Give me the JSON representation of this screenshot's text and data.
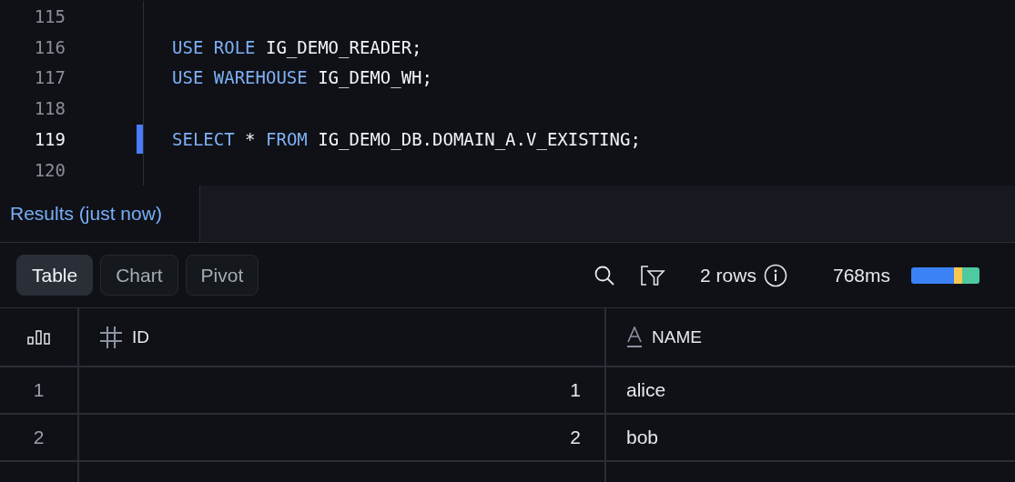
{
  "editor": {
    "lines": [
      {
        "number": "115",
        "current": false
      },
      {
        "number": "116",
        "current": false,
        "tokens": [
          {
            "kind": "keyword",
            "text": "USE ROLE"
          },
          {
            "kind": "ident",
            "text": "IG_DEMO_READER;"
          }
        ]
      },
      {
        "number": "117",
        "current": false,
        "tokens": [
          {
            "kind": "keyword",
            "text": "USE WAREHOUSE"
          },
          {
            "kind": "ident",
            "text": "IG_DEMO_WH;"
          }
        ]
      },
      {
        "number": "118",
        "current": false
      },
      {
        "number": "119",
        "current": true,
        "tokens": [
          {
            "kind": "keyword",
            "text": "SELECT"
          },
          {
            "kind": "ident",
            "text": "*"
          },
          {
            "kind": "keyword",
            "text": "FROM"
          },
          {
            "kind": "ident",
            "text": "IG_DEMO_DB.DOMAIN_A.V_EXISTING;"
          }
        ]
      },
      {
        "number": "120",
        "current": false
      }
    ]
  },
  "results": {
    "tab": {
      "label": "Results (just now)",
      "selected": true
    },
    "views": [
      {
        "label": "Table",
        "selected": true
      },
      {
        "label": "Chart",
        "selected": false
      },
      {
        "label": "Pivot",
        "selected": false
      }
    ],
    "row_count": "2 rows",
    "duration": "768ms",
    "timing": [
      {
        "color": "#3b82f6"
      },
      {
        "color": "#f9c74f"
      },
      {
        "color": "#4fc9a0"
      }
    ],
    "table": {
      "columns": [
        {
          "kind": "number",
          "label": "ID"
        },
        {
          "kind": "text",
          "label": "NAME"
        }
      ],
      "rows": [
        {
          "index": "1",
          "cells": [
            "1",
            "alice"
          ]
        },
        {
          "index": "2",
          "cells": [
            "2",
            "bob"
          ]
        }
      ]
    }
  }
}
